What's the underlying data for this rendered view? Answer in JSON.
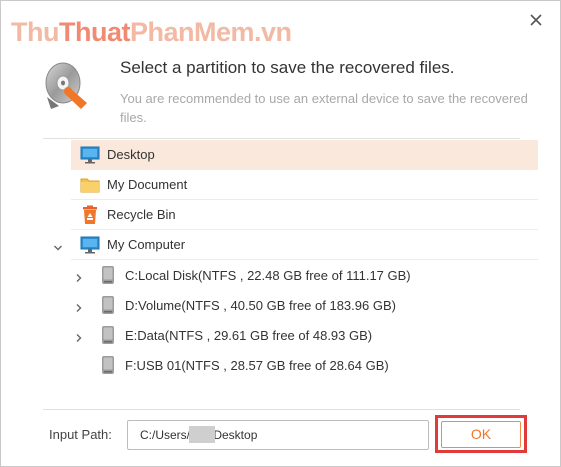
{
  "watermark": {
    "part1": "Thu",
    "part2": "Thuat",
    "part3": "PhanMem.vn"
  },
  "header": {
    "title": "Select a partition to save the recovered files.",
    "subtitle": "You are recommended to use an external device to save the recovered files."
  },
  "tree": {
    "desktop": "Desktop",
    "my_document": "My Document",
    "recycle_bin": "Recycle Bin",
    "my_computer": "My Computer",
    "drives": [
      {
        "label": "C:Local Disk(NTFS , 22.48 GB free of 111.17 GB)",
        "expandable": true
      },
      {
        "label": "D:Volume(NTFS , 40.50 GB free of 183.96 GB)",
        "expandable": true
      },
      {
        "label": "E:Data(NTFS , 29.61 GB free of 48.93 GB)",
        "expandable": true
      },
      {
        "label": "F:USB 01(NTFS , 28.57 GB free of 28.64 GB)",
        "expandable": false
      }
    ]
  },
  "footer": {
    "input_label": "Input Path:",
    "input_value": "C:/Users/      /Desktop",
    "ok_label": "OK"
  },
  "colors": {
    "accent": "#f0762a",
    "selected_row": "#fbe8dc",
    "highlight_box": "#e03a3a"
  }
}
